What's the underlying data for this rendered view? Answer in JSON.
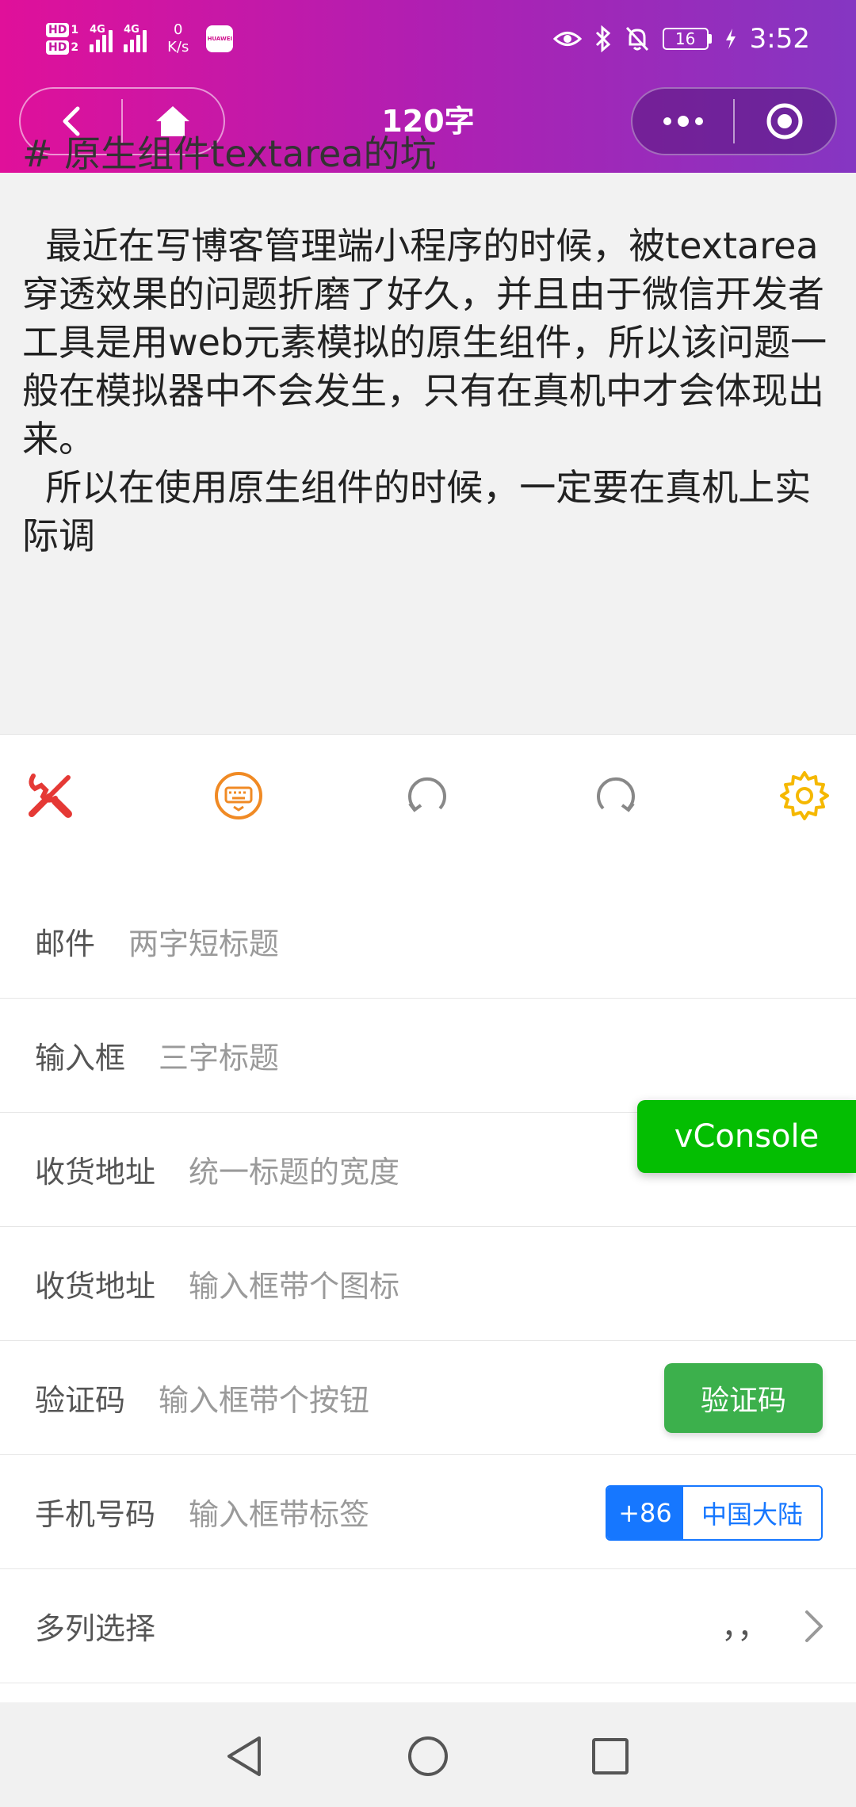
{
  "status_bar": {
    "hd1": "HD",
    "hd1_num": "1",
    "hd2": "HD",
    "hd2_num": "2",
    "net1": "4G",
    "net2": "4G",
    "speed_value": "0",
    "speed_unit": "K/s",
    "app_badge": "HUAWEI",
    "battery": "16",
    "time": "3:52"
  },
  "nav": {
    "title": "120字"
  },
  "editor": {
    "heading": "# 原生组件textarea的坑",
    "body": "  最近在写博客管理端小程序的时候，被textarea穿透效果的问题折磨了好久，并且由于微信开发者工具是用web元素模拟的原生组件，所以该问题一般在模拟器中不会发生，只有在真机中才会体现出来。\n  所以在使用原生组件的时候，一定要在真机上实际调"
  },
  "toolbar": {
    "icons": [
      "tools-icon",
      "keyboard-icon",
      "undo-icon",
      "redo-icon",
      "settings-icon"
    ],
    "colors": {
      "tools": "#e53935",
      "keyboard": "#f08a24",
      "undo": "#888888",
      "redo": "#888888",
      "settings": "#f5b800"
    }
  },
  "form": {
    "email": {
      "label": "邮件",
      "placeholder": "两字短标题"
    },
    "input_box": {
      "label": "输入框",
      "placeholder": "三字标题"
    },
    "address1": {
      "label": "收货地址",
      "placeholder": "统一标题的宽度"
    },
    "address2": {
      "label": "收货地址",
      "placeholder": "输入框带个图标"
    },
    "verify": {
      "label": "验证码",
      "placeholder": "输入框带个按钮",
      "button": "验证码"
    },
    "phone": {
      "label": "手机号码",
      "placeholder": "输入框带标签",
      "code": "+86",
      "region": "中国大陆"
    },
    "multi": {
      "label": "多列选择",
      "value": "，，"
    }
  },
  "vconsole": {
    "label": "vConsole"
  },
  "theme": {
    "header_gradient_start": "#e0109a",
    "header_gradient_end": "#8536c2",
    "verify_button": "#3cb04c",
    "phone_tag": "#1677ff",
    "vconsole": "#04be02"
  }
}
